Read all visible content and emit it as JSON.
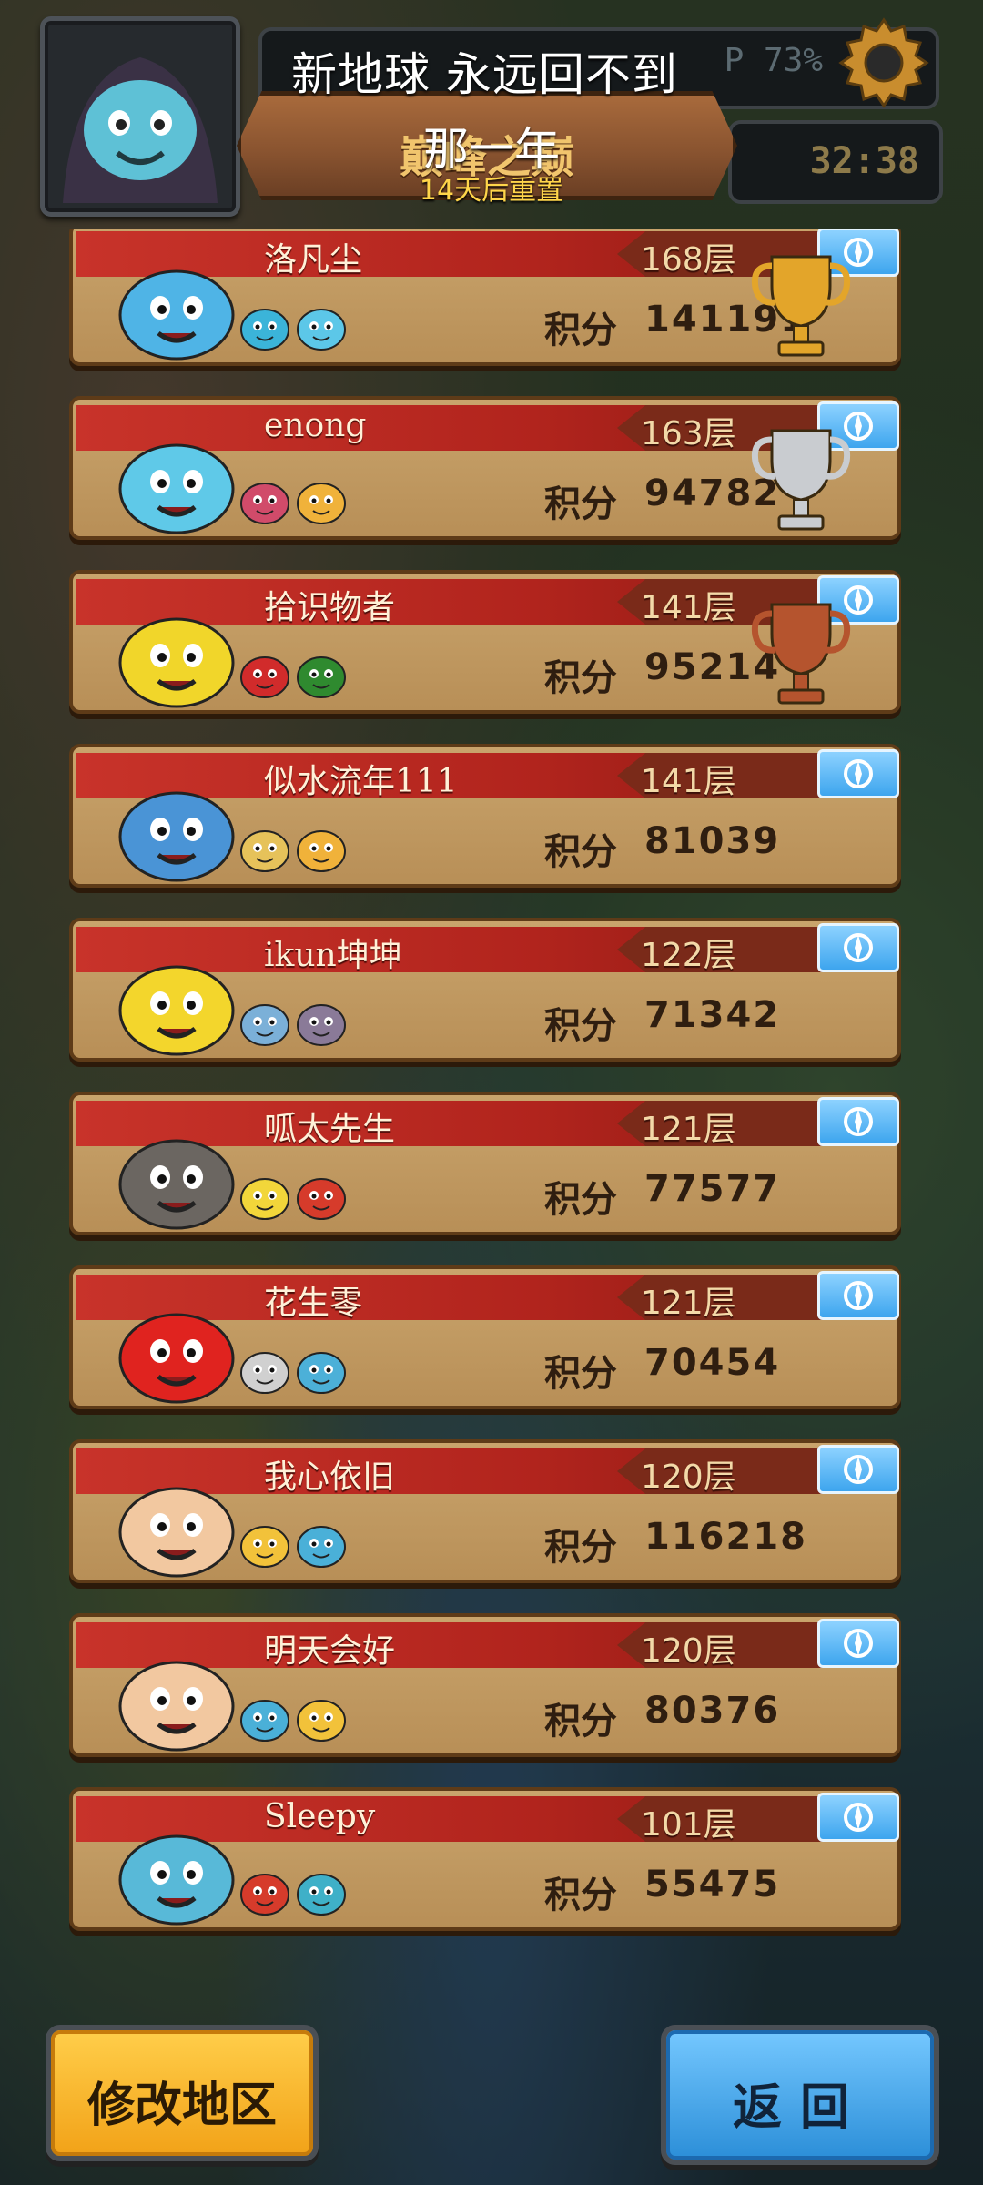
{
  "header": {
    "progress_text": "P 73%",
    "timer": "32:38",
    "banner_title": "巅峰之巅",
    "reset_text": "14天后重置"
  },
  "overlay": {
    "caption_line1": "新地球 永远回不到",
    "caption_line2": "那一年"
  },
  "leaderboard": [
    {
      "name": "洛凡尘",
      "floor": "168层",
      "score_label": "积分",
      "score": "141191",
      "trophy": "gold",
      "badge": "swirl-icon",
      "avatar_color": "#4fb4e6"
    },
    {
      "name": "enong",
      "floor": "163层",
      "score_label": "积分",
      "score": "94782",
      "trophy": "silver",
      "badge": "lion-icon",
      "avatar_color": "#5fc9e8"
    },
    {
      "name": "拾识物者",
      "floor": "141层",
      "score_label": "积分",
      "score": "95214",
      "trophy": "bronze",
      "badge": "swirl-icon",
      "avatar_color": "#f1d62a"
    },
    {
      "name": "似水流年111",
      "floor": "141层",
      "score_label": "积分",
      "score": "81039",
      "trophy": "",
      "badge": "mask-icon",
      "avatar_color": "#4a94d6"
    },
    {
      "name": "ikun坤坤",
      "floor": "122层",
      "score_label": "积分",
      "score": "71342",
      "trophy": "",
      "badge": "wings-icon",
      "avatar_color": "#f3d62c"
    },
    {
      "name": "呱太先生",
      "floor": "121层",
      "score_label": "积分",
      "score": "77577",
      "trophy": "",
      "badge": "wings-icon",
      "avatar_color": "#6b6661"
    },
    {
      "name": "花生零",
      "floor": "121层",
      "score_label": "积分",
      "score": "70454",
      "trophy": "",
      "badge": "swirl-icon",
      "avatar_color": "#e0231f"
    },
    {
      "name": "我心依旧",
      "floor": "120层",
      "score_label": "积分",
      "score": "116218",
      "trophy": "",
      "badge": "wings-icon",
      "avatar_color": "#f2c8a0"
    },
    {
      "name": "明天会好",
      "floor": "120层",
      "score_label": "积分",
      "score": "80376",
      "trophy": "",
      "badge": "pumpkin-icon",
      "avatar_color": "#f2c8a0"
    },
    {
      "name": "Sleepy",
      "floor": "101层",
      "score_label": "积分",
      "score": "55475",
      "trophy": "",
      "badge": "swirl-icon",
      "avatar_color": "#58b9d8"
    }
  ],
  "buttons": {
    "modify_label": "修改地区",
    "back_label": "返回"
  },
  "colors": {
    "gold": "#e3a52a",
    "silver": "#c9ccd0",
    "bronze": "#b5542e"
  }
}
